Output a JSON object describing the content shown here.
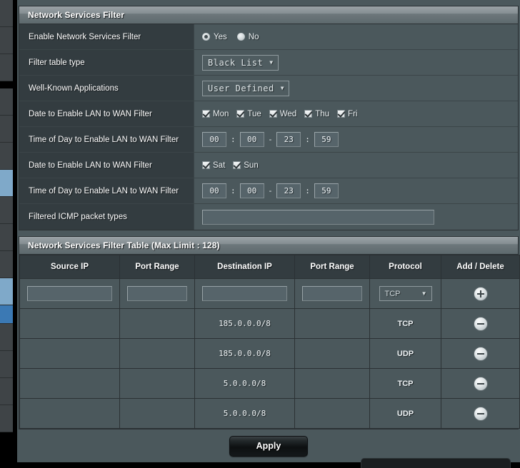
{
  "settings_panel": {
    "title": "Network Services Filter",
    "rows": [
      {
        "label": "Enable Network Services Filter",
        "type": "radio",
        "options": [
          {
            "label": "Yes",
            "checked": true
          },
          {
            "label": "No",
            "checked": false
          }
        ]
      },
      {
        "label": "Filter table type",
        "type": "select",
        "value": "Black List"
      },
      {
        "label": "Well-Known Applications",
        "type": "select",
        "value": "User Defined"
      },
      {
        "label": "Date to Enable LAN to WAN Filter",
        "type": "checkboxes",
        "days": [
          {
            "label": "Mon",
            "checked": true
          },
          {
            "label": "Tue",
            "checked": true
          },
          {
            "label": "Wed",
            "checked": true
          },
          {
            "label": "Thu",
            "checked": true
          },
          {
            "label": "Fri",
            "checked": true
          }
        ]
      },
      {
        "label": "Time of Day to Enable LAN to WAN Filter",
        "type": "time",
        "start_hour": "00",
        "start_min": "00",
        "end_hour": "23",
        "end_min": "59"
      },
      {
        "label": "Date to Enable LAN to WAN Filter",
        "type": "checkboxes",
        "days": [
          {
            "label": "Sat",
            "checked": true
          },
          {
            "label": "Sun",
            "checked": true
          }
        ]
      },
      {
        "label": "Time of Day to Enable LAN to WAN Filter",
        "type": "time",
        "start_hour": "00",
        "start_min": "00",
        "end_hour": "23",
        "end_min": "59"
      },
      {
        "label": "Filtered ICMP packet types",
        "type": "text",
        "value": ""
      }
    ],
    "time_separator": ":",
    "time_dash": "-"
  },
  "table_panel": {
    "title": "Network Services Filter Table (Max Limit : 128)",
    "columns": [
      "Source IP",
      "Port Range",
      "Destination IP",
      "Port Range",
      "Protocol",
      "Add / Delete"
    ],
    "entry_row": {
      "source_ip": "",
      "source_port": "",
      "dest_ip": "",
      "dest_port": "",
      "protocol": "TCP",
      "action_icon": "plus-circle-icon"
    },
    "rows": [
      {
        "source_ip": "",
        "source_port": "",
        "dest_ip": "185.0.0.0/8",
        "dest_port": "",
        "protocol": "TCP",
        "action_icon": "minus-circle-icon"
      },
      {
        "source_ip": "",
        "source_port": "",
        "dest_ip": "185.0.0.0/8",
        "dest_port": "",
        "protocol": "UDP",
        "action_icon": "minus-circle-icon"
      },
      {
        "source_ip": "",
        "source_port": "",
        "dest_ip": "5.0.0.0/8",
        "dest_port": "",
        "protocol": "TCP",
        "action_icon": "minus-circle-icon"
      },
      {
        "source_ip": "",
        "source_port": "",
        "dest_ip": "5.0.0.0/8",
        "dest_port": "",
        "protocol": "UDP",
        "action_icon": "minus-circle-icon"
      }
    ]
  },
  "footer": {
    "apply_label": "Apply"
  },
  "sidebar": {
    "items": [
      {
        "state": "normal"
      },
      {
        "state": "normal"
      },
      {
        "state": "normal"
      },
      {
        "state": "gap"
      },
      {
        "state": "normal"
      },
      {
        "state": "normal"
      },
      {
        "state": "normal"
      },
      {
        "state": "selected-light"
      },
      {
        "state": "normal"
      },
      {
        "state": "normal"
      },
      {
        "state": "normal"
      },
      {
        "state": "selected-light"
      },
      {
        "state": "selected-dark"
      },
      {
        "state": "normal"
      },
      {
        "state": "normal"
      },
      {
        "state": "normal"
      },
      {
        "state": "normal"
      }
    ]
  },
  "colors": {
    "page_bg": "#4b585c",
    "label_bg": "#333c40",
    "panel_border": "#2b3134",
    "accent_selected": "#3b79b4",
    "text": "#ffffff"
  }
}
